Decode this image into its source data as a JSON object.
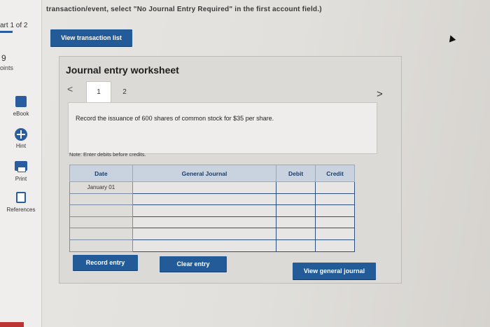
{
  "header": {
    "text": "transaction/event, select \"No Journal Entry Required\" in the first account field.)"
  },
  "left_rail": {
    "part": "art 1 of 2",
    "points_value": "9",
    "points_label": "oints",
    "tools": [
      {
        "label": "eBook",
        "icon": "book-icon"
      },
      {
        "label": "Hint",
        "icon": "hint-icon"
      },
      {
        "label": "Print",
        "icon": "print-icon"
      },
      {
        "label": "References",
        "icon": "references-icon"
      }
    ]
  },
  "buttons": {
    "view_transaction_list": "View transaction list",
    "record_entry": "Record entry",
    "clear_entry": "Clear entry",
    "view_general_journal": "View general journal"
  },
  "worksheet": {
    "title": "Journal entry worksheet",
    "tabs": [
      "1",
      "2"
    ],
    "prev": "<",
    "next": ">",
    "instruction": "Record the issuance of 600 shares of common stock for $35 per share.",
    "note": "Note: Enter debits before credits."
  },
  "journal": {
    "headers": [
      "Date",
      "General Journal",
      "Debit",
      "Credit"
    ],
    "rows": [
      [
        "January 01",
        "",
        "",
        ""
      ],
      [
        "",
        "",
        "",
        ""
      ],
      [
        "",
        "",
        "",
        ""
      ],
      [
        "",
        "",
        "",
        ""
      ],
      [
        "",
        "",
        "",
        ""
      ],
      [
        "",
        "",
        "",
        ""
      ]
    ]
  },
  "colors": {
    "accent": "#235a98",
    "table_header": "#c9d3e0"
  }
}
